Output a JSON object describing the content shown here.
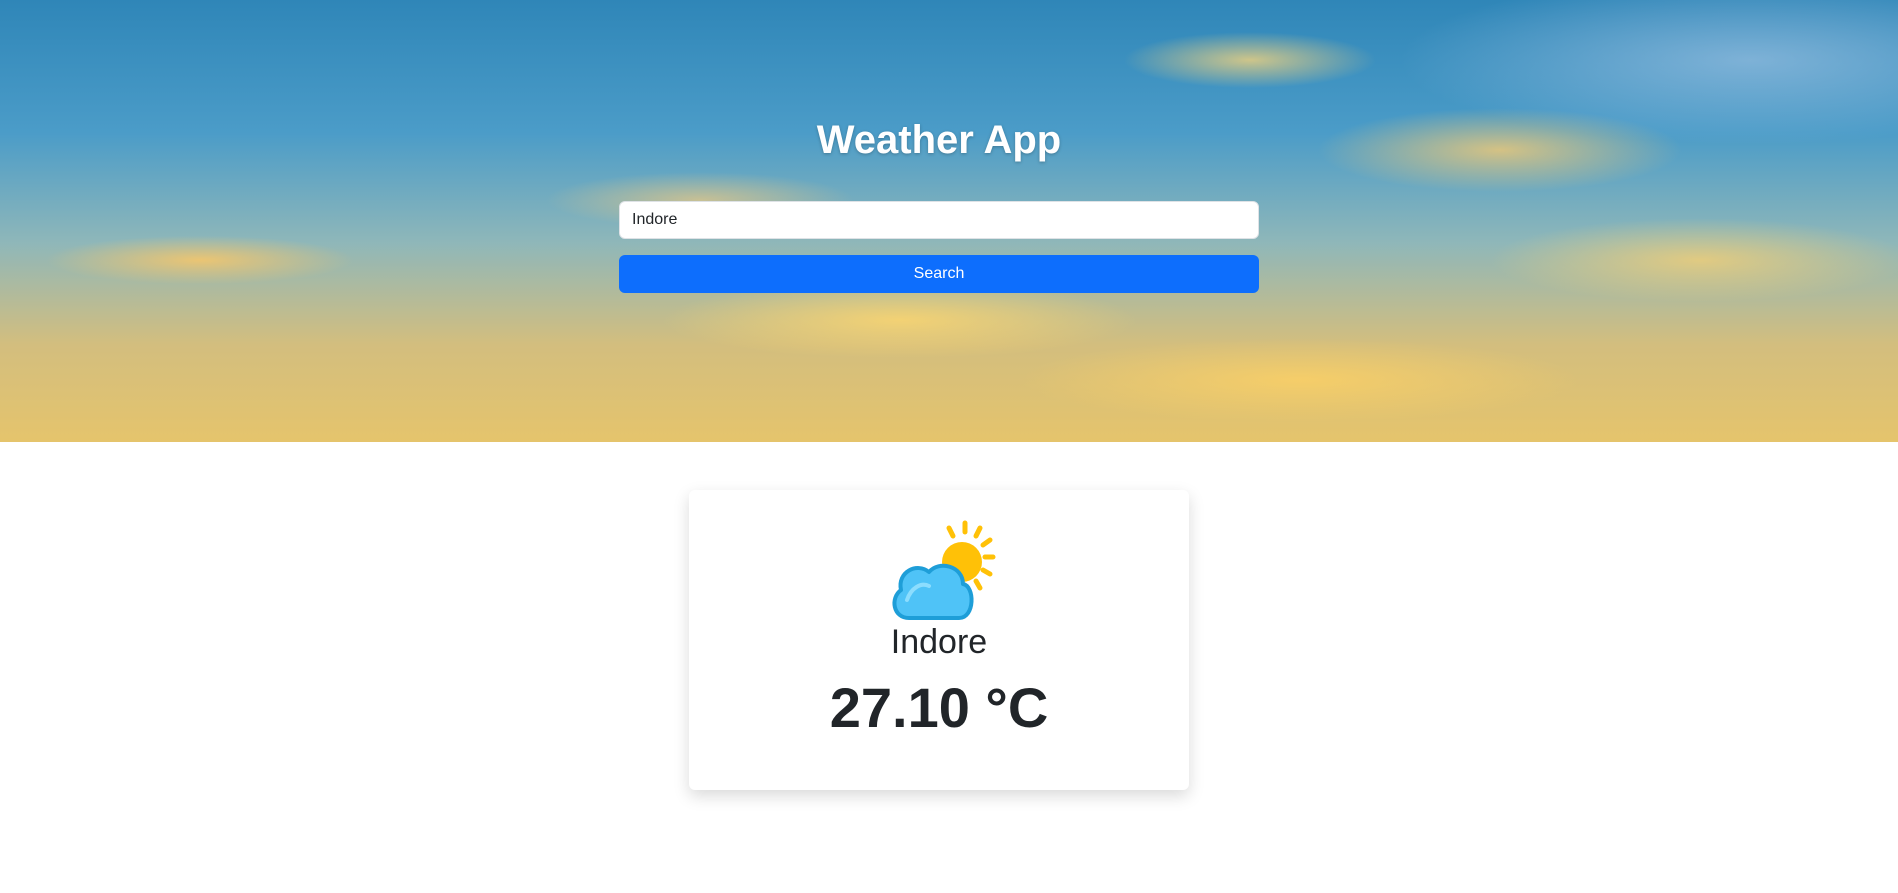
{
  "header": {
    "title": "Weather App"
  },
  "search": {
    "value": "Indore",
    "button_label": "Search"
  },
  "weather_card": {
    "icon": "cloud-sun-icon",
    "city": "Indore",
    "temperature": "27.10 °C"
  },
  "colors": {
    "button": "#0d6efd",
    "cloud": "#4fc3f7",
    "sun": "#ffc107",
    "text": "#212529"
  }
}
